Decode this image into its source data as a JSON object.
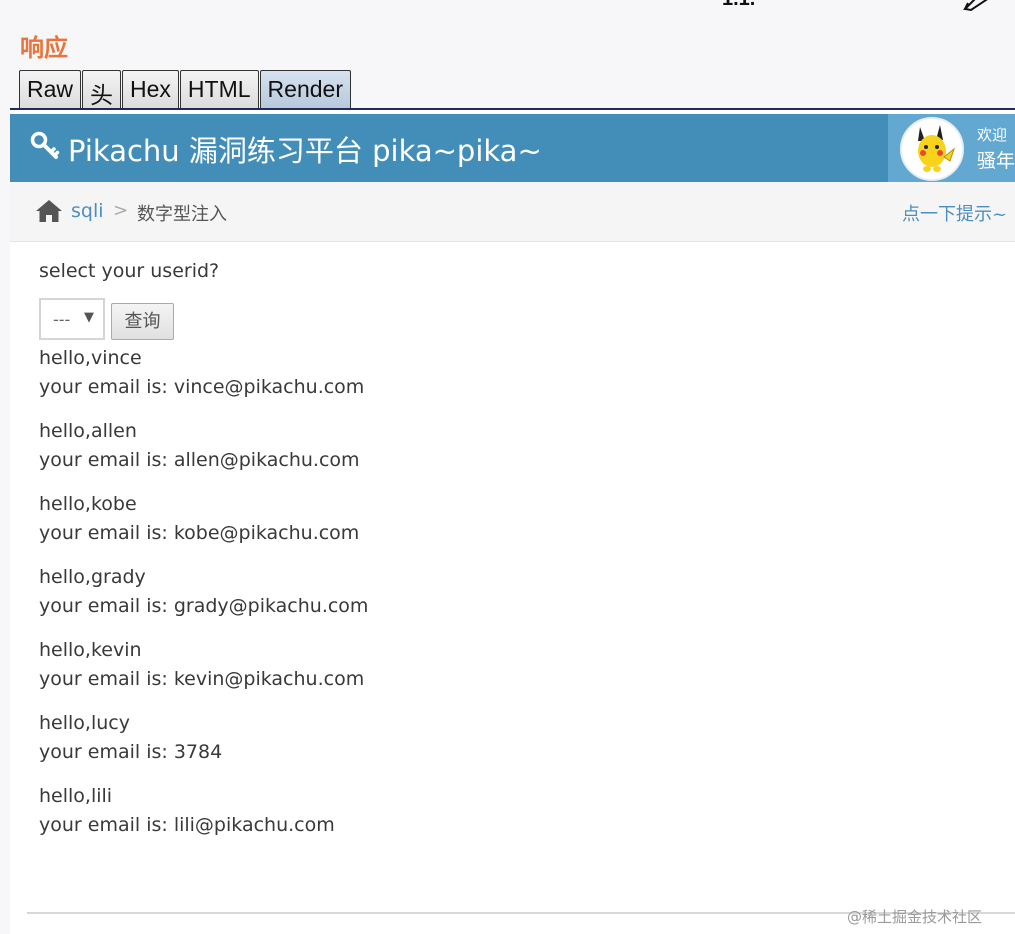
{
  "header_clip": "1.1.",
  "response_title": "响应",
  "tabs": [
    {
      "label": "Raw",
      "active": false
    },
    {
      "label": "头",
      "active": false
    },
    {
      "label": "Hex",
      "active": false
    },
    {
      "label": "HTML",
      "active": false
    },
    {
      "label": "Render",
      "active": true
    }
  ],
  "page": {
    "brand": "Pikachu 漏洞练习平台 pika~pika~",
    "welcome": "欢迎",
    "username": "骚年",
    "breadcrumb": {
      "link": "sqli",
      "separator": ">",
      "current": "数字型注入",
      "hint": "点一下提示~"
    },
    "prompt": "select your userid?",
    "select_value": "---",
    "query_button": "查询",
    "results": [
      {
        "hello": "hello,vince",
        "email": "your email is: vince@pikachu.com"
      },
      {
        "hello": "hello,allen",
        "email": "your email is: allen@pikachu.com"
      },
      {
        "hello": "hello,kobe",
        "email": "your email is: kobe@pikachu.com"
      },
      {
        "hello": "hello,grady",
        "email": "your email is: grady@pikachu.com"
      },
      {
        "hello": "hello,kevin",
        "email": "your email is: kevin@pikachu.com"
      },
      {
        "hello": "hello,lucy",
        "email": "your email is: 3784"
      },
      {
        "hello": "hello,lili",
        "email": "your email is: lili@pikachu.com"
      }
    ],
    "watermark": "@稀土掘金技术社区"
  },
  "colors": {
    "navbar": "#438eb9",
    "accent_title": "#e8743b",
    "link": "#4c8fbd"
  },
  "icons": [
    "key-icon",
    "home-icon",
    "pen-icon",
    "pikachu-avatar"
  ]
}
